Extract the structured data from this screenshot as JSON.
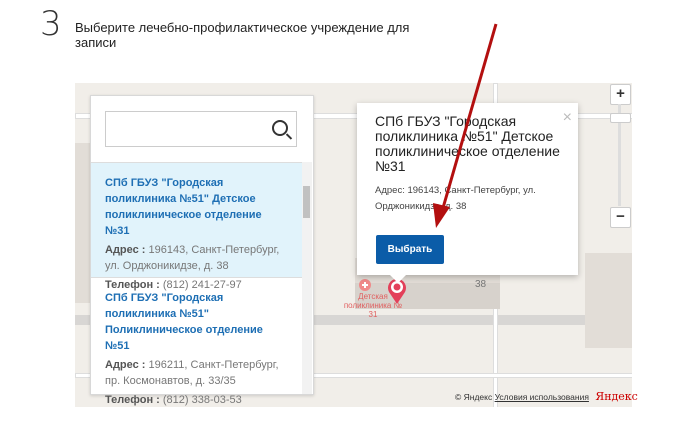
{
  "step": {
    "number": "3",
    "title": "Выберите лечебно-профилактическое учреждение для записи"
  },
  "search": {
    "value": "",
    "placeholder": ""
  },
  "list": [
    {
      "name": "СПб ГБУЗ \"Городская поликлиника №51\" Детское поликлиническое отделение №31",
      "address_label": "Адрес :",
      "address": "196143, Санкт-Петербург, ул. Орджоникидзе, д. 38",
      "phone_label": "Телефон :",
      "phone": "(812) 241-27-97",
      "selected": true
    },
    {
      "name": "СПб ГБУЗ \"Городская поликлиника №51\" Поликлиническое отделение №51",
      "address_label": "Адрес :",
      "address": "196211, Санкт-Петербург, пр. Космонавтов, д. 33/35",
      "phone_label": "Телефон :",
      "phone": "(812) 338-03-53",
      "selected": false
    }
  ],
  "popup": {
    "title": "СПб ГБУЗ \"Городская поликлиника №51\" Детское поликлиническое отделение №31",
    "address": "Адрес: 196143, Санкт-Петербург, ул. Орджоникидзе, д. 38",
    "button": "Выбрать",
    "close": "×"
  },
  "map": {
    "pin_label": "Детская поликлиника № 31",
    "house_number": "38",
    "zoom_in": "+",
    "zoom_out": "−",
    "copyright": "© Яндекс",
    "terms": "Условия использования",
    "logo": "Яндекс"
  },
  "colors": {
    "accent": "#0b5ca8",
    "link": "#1e6fb4",
    "selected_bg": "#e1f3fb",
    "arrow": "#b30f0f"
  }
}
